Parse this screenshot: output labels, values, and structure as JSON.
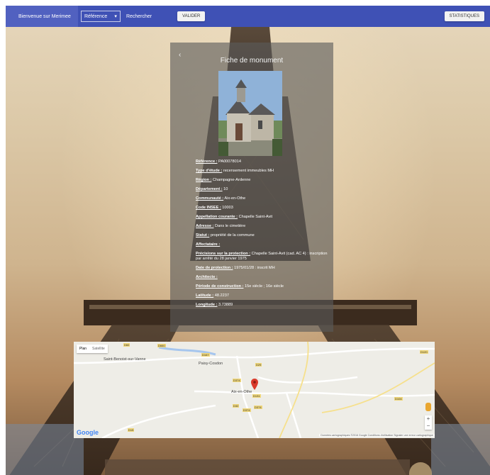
{
  "navbar": {
    "brand": "Bienvenue sur Merimee",
    "select_value": "Référence",
    "search_label": "Rechercher",
    "valider": "VALIDER",
    "statistiques": "STATISTIQUES"
  },
  "card": {
    "back": "‹",
    "title": "Fiche de monument",
    "fields": [
      {
        "label": "Référence :",
        "value": " PA00078014"
      },
      {
        "label": "Type d'étude :",
        "value": " recensement immeubles MH"
      },
      {
        "label": "Région :",
        "value": " Champagne-Ardenne"
      },
      {
        "label": "Département :",
        "value": " 10"
      },
      {
        "label": "Communauté :",
        "value": " Aix-en-Othe"
      },
      {
        "label": "Code INSEE :",
        "value": " 10003"
      },
      {
        "label": "Appellation courante :",
        "value": " Chapelle Saint-Avit"
      },
      {
        "label": "Adresse :",
        "value": " Dans le cimetière"
      },
      {
        "label": "Statut :",
        "value": " propriété de la commune"
      },
      {
        "label": "Affectataire :",
        "value": ""
      },
      {
        "label": "Précisions sur la protection :",
        "value": " Chapelle Saint-Avit (cad. AC 4) : inscription par arrêté du 28 janvier 1975"
      },
      {
        "label": "Date de protection :",
        "value": " 1975/01/28 : inscrit MH"
      },
      {
        "label": "Architecte :",
        "value": ""
      },
      {
        "label": "Période de construction :",
        "value": " 15e siècle ; 16e siècle"
      },
      {
        "label": "Latitude :",
        "value": " 48.2237"
      },
      {
        "label": "Longitude :",
        "value": " 3.73889"
      }
    ]
  },
  "map": {
    "tab_plan": "Plan",
    "tab_satellite": "Satellite",
    "places": {
      "saint_benoist": "Saint-Benoist-sur-Vanne",
      "paisy": "Paisy-Cosdon",
      "aix": "Aix-en-Othe"
    },
    "roads": [
      "D660",
      "D60",
      "D167",
      "D29",
      "D374",
      "D131",
      "D32",
      "D374",
      "D374",
      "D104",
      "D120",
      "D15"
    ],
    "google": "Google",
    "attribution": "Données cartographiques ©2016 Google    Conditions d'utilisation    Signaler une erreur cartographique",
    "zoom_in": "+",
    "zoom_out": "−"
  },
  "colors": {
    "navbar": "#3f51b5",
    "brand_bg": "#5161c0",
    "marker": "#d93a2b"
  }
}
